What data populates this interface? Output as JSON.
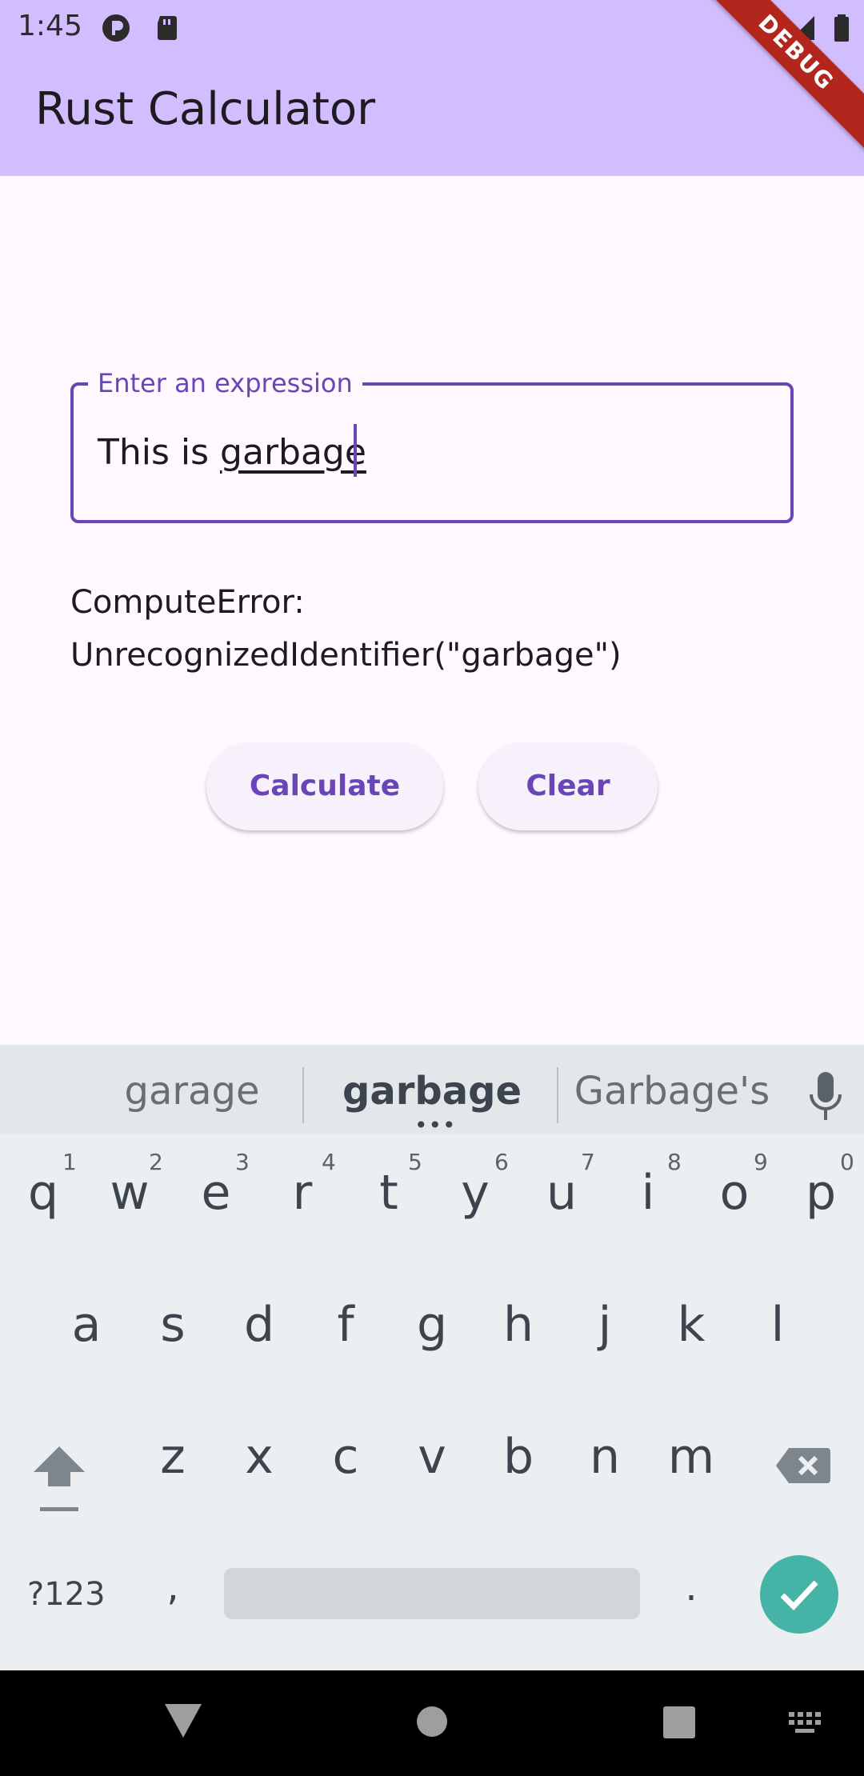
{
  "status_bar": {
    "time": "1:45",
    "icons": [
      "app-notification-icon",
      "sd-card-icon",
      "wifi-icon",
      "signal-icon",
      "battery-icon"
    ]
  },
  "app_bar": {
    "title": "Rust Calculator",
    "background": "#D2BEFE",
    "debug_banner": "DEBUG"
  },
  "expression_field": {
    "label": "Enter an expression",
    "value_prefix": "This is ",
    "value_word": "garbage",
    "accent": "#6A45B8"
  },
  "result": {
    "line1": "ComputeError:",
    "line2": "UnrecognizedIdentifier(\"garbage\")"
  },
  "buttons": {
    "calculate": "Calculate",
    "clear": "Clear"
  },
  "keyboard": {
    "suggestions": [
      "garage",
      "garbage",
      "Garbage's"
    ],
    "row1": [
      "q",
      "w",
      "e",
      "r",
      "t",
      "y",
      "u",
      "i",
      "o",
      "p"
    ],
    "row1_hints": [
      "1",
      "2",
      "3",
      "4",
      "5",
      "6",
      "7",
      "8",
      "9",
      "0"
    ],
    "row2": [
      "a",
      "s",
      "d",
      "f",
      "g",
      "h",
      "j",
      "k",
      "l"
    ],
    "row3": [
      "z",
      "x",
      "c",
      "v",
      "b",
      "n",
      "m"
    ],
    "symbols_key": "?123",
    "comma_key": ",",
    "period_key": ".",
    "enter_color": "#45B3A6"
  },
  "nav_bar": {
    "icons": [
      "back-icon",
      "home-icon",
      "recents-icon",
      "keyboard-switch-icon"
    ]
  }
}
